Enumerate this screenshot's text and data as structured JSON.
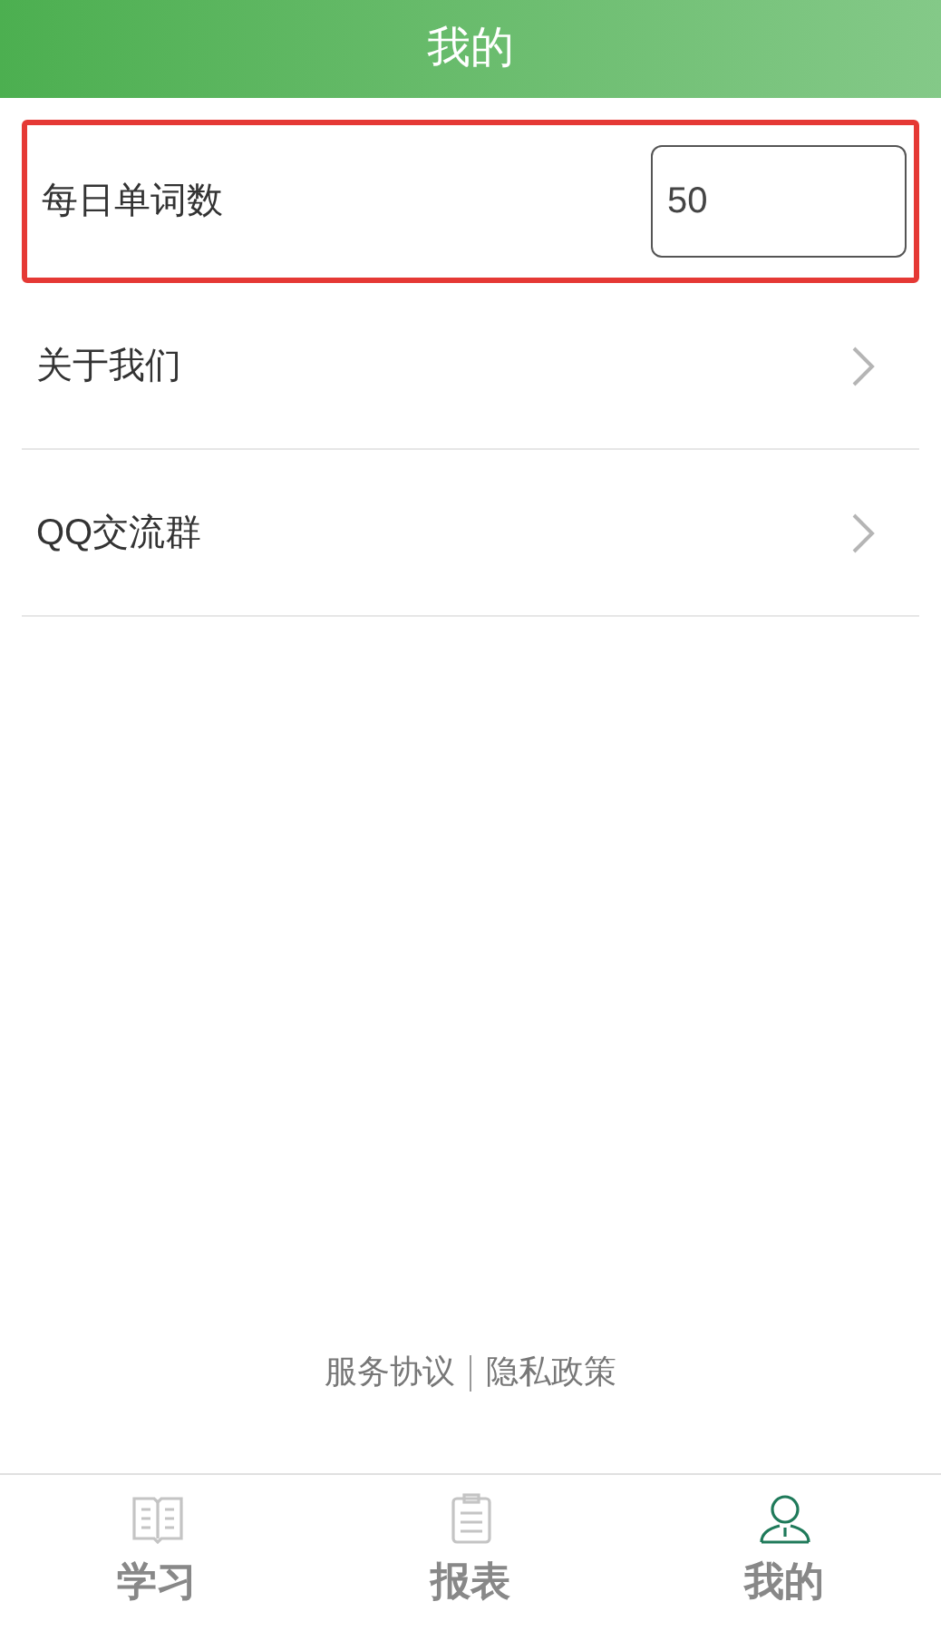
{
  "header": {
    "title": "我的"
  },
  "settings": [
    {
      "kind": "input",
      "label": "每日单词数",
      "value": "50",
      "highlighted": true
    },
    {
      "kind": "link",
      "label": "关于我们",
      "highlighted": false
    },
    {
      "kind": "link",
      "label": "QQ交流群",
      "highlighted": false
    }
  ],
  "footer_links": [
    "服务协议",
    "隐私政策"
  ],
  "tabs": [
    {
      "kind": "book",
      "label": "学习",
      "selected": false
    },
    {
      "kind": "clipboard",
      "label": "报表",
      "selected": false
    },
    {
      "kind": "person",
      "label": "我的",
      "selected": true
    }
  ]
}
